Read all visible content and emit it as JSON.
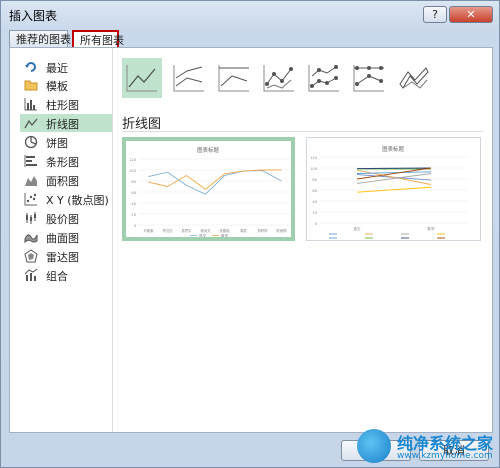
{
  "dialog": {
    "title": "插入图表",
    "help_label": "?",
    "close_label": "✕"
  },
  "tabs": [
    {
      "label": "推荐的图表"
    },
    {
      "label": "所有图表",
      "selected": true
    }
  ],
  "sidebar": {
    "items": [
      {
        "label": "最近",
        "icon": "recent-icon"
      },
      {
        "label": "模板",
        "icon": "folder-icon"
      },
      {
        "label": "柱形图",
        "icon": "column-chart-icon"
      },
      {
        "label": "折线图",
        "icon": "line-chart-icon",
        "selected": true
      },
      {
        "label": "饼图",
        "icon": "pie-chart-icon"
      },
      {
        "label": "条形图",
        "icon": "bar-chart-icon"
      },
      {
        "label": "面积图",
        "icon": "area-chart-icon"
      },
      {
        "label": "X Y (散点图)",
        "icon": "scatter-chart-icon"
      },
      {
        "label": "股价图",
        "icon": "stock-chart-icon"
      },
      {
        "label": "曲面图",
        "icon": "surface-chart-icon"
      },
      {
        "label": "雷达图",
        "icon": "radar-chart-icon"
      },
      {
        "label": "组合",
        "icon": "combo-chart-icon"
      }
    ]
  },
  "subtypes": [
    {
      "name": "line",
      "selected": true
    },
    {
      "name": "stacked-line"
    },
    {
      "name": "100-stacked-line"
    },
    {
      "name": "line-markers"
    },
    {
      "name": "stacked-line-markers"
    },
    {
      "name": "100-stacked-line-markers"
    },
    {
      "name": "3d-line"
    }
  ],
  "section_title": "折线图",
  "previews": [
    {
      "chart_title": "图表标题",
      "selected": true,
      "ytick_labels": [
        "120",
        "100",
        "80",
        "60",
        "40",
        "20",
        "0"
      ],
      "legend": [
        "语文",
        "数学"
      ]
    },
    {
      "chart_title": "图表标题",
      "selected": false,
      "ytick_labels": [
        "120",
        "100",
        "80",
        "60",
        "40",
        "20",
        "0"
      ],
      "categories": [
        "语文",
        "数学"
      ]
    }
  ],
  "chart_data": [
    {
      "type": "line",
      "title": "图表标题",
      "categories": [
        "刘素素",
        "李沉沉",
        "易思宇",
        "杨诗文",
        "张春艳",
        "周药",
        "郑婷婷",
        "陈雨桐"
      ],
      "series": [
        {
          "name": "语文",
          "values": [
            88,
            96,
            72,
            56,
            90,
            98,
            99,
            80
          ]
        },
        {
          "name": "数学",
          "values": [
            78,
            70,
            90,
            65,
            93,
            98,
            100,
            100
          ]
        }
      ],
      "ylim": [
        0,
        120
      ],
      "grid": true,
      "legend": "bottom",
      "colors": [
        "#7fb2d8",
        "#f0a94c"
      ]
    },
    {
      "type": "line",
      "title": "图表标题",
      "categories": [
        "语文",
        "数学"
      ],
      "series": [
        {
          "values": [
            88,
            78
          ]
        },
        {
          "values": [
            96,
            70
          ]
        },
        {
          "values": [
            72,
            90
          ]
        },
        {
          "values": [
            56,
            65
          ]
        },
        {
          "values": [
            90,
            93
          ]
        },
        {
          "values": [
            98,
            98
          ]
        },
        {
          "values": [
            99,
            100
          ]
        },
        {
          "values": [
            80,
            100
          ]
        }
      ],
      "ylim": [
        0,
        120
      ],
      "grid": true,
      "legend": "bottom",
      "colors": [
        "#6f8fc9",
        "#f0a94c",
        "#a5a5a5",
        "#ffc000",
        "#5b9bd5",
        "#70ad47",
        "#264478",
        "#9e480e"
      ]
    }
  ],
  "buttons": {
    "ok": "确定",
    "cancel": "取消"
  },
  "watermark": {
    "text": "纯净系统之家",
    "url": "www.kzmyhome.com"
  }
}
